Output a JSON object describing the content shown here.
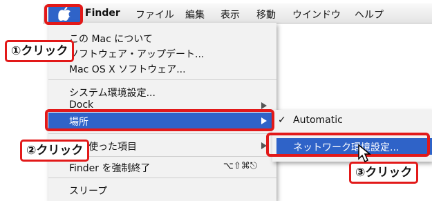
{
  "menubar": {
    "app": "Finder",
    "items": [
      "ファイル",
      "編集",
      "表示",
      "移動",
      "ウインドウ",
      "ヘルプ"
    ]
  },
  "apple_menu": {
    "items": [
      {
        "label": "この Mac について"
      },
      {
        "label": "ソフトウェア・アップデート..."
      },
      {
        "label": "Mac OS X ソフトウェア..."
      },
      {
        "label": "システム環境設定..."
      },
      {
        "label": "Dock"
      },
      {
        "label": "場所"
      },
      {
        "label": "最近使った項目"
      },
      {
        "label": "Finder を強制終了",
        "shortcut": "⌥⇧⌘⎋"
      },
      {
        "label": "スリープ"
      }
    ]
  },
  "location_submenu": {
    "items": [
      {
        "label": "Automatic",
        "check": "✓"
      },
      {
        "label": "ネットワーク環境設定..."
      }
    ]
  },
  "callouts": {
    "step1": "①クリック",
    "step2": "②クリック",
    "step3": "③クリック"
  },
  "colors": {
    "highlight": "#2f63c8",
    "annotation_red": "#e21919"
  }
}
